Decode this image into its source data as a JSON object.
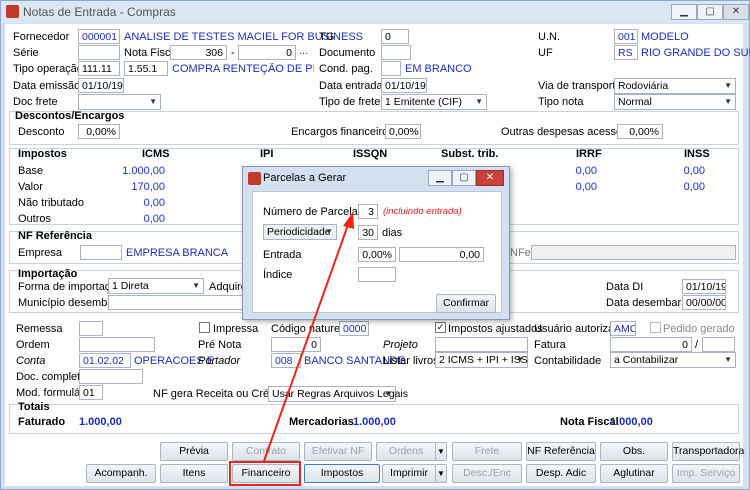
{
  "window": {
    "title": "Notas de Entrada - Compras"
  },
  "header": {
    "fornecedor_label": "Fornecedor",
    "fornecedor_code": "000001",
    "fornecedor_name": "ANALISE DE TESTES MACIEL FOR BUSINESS",
    "tg_label": "TG",
    "tg_value": "0",
    "un_label": "U.N.",
    "un_code": "001",
    "un_name": "MODELO",
    "serie_label": "Série",
    "nota_fiscal_label": "Nota Fiscal",
    "nota_fiscal_value": "306",
    "nota_dash": "-",
    "nota_suffix": "0",
    "ellipsis": "...",
    "documento_label": "Documento",
    "uf_label": "UF",
    "uf_code": "RS",
    "uf_name": "RIO GRANDE DO SUL",
    "tipo_operacao_label": "Tipo operação",
    "tipo_op_code": "111.11",
    "tipo_op_cfop": "1.55.1",
    "tipo_op_desc": "COMPRA RENTEÇÃO DE PIS + COFI",
    "cond_pag_label": "Cond. pag.",
    "cond_pag_desc": "EM BRANCO",
    "data_emissao_label": "Data emissão",
    "data_emissao_value": "01/10/19",
    "data_entrada_label": "Data entrada",
    "data_entrada_value": "01/10/19",
    "via_transporte_label": "Via de transporte",
    "via_transporte_value": "Rodoviária",
    "doc_frete_label": "Doc frete",
    "tipo_frete_label": "Tipo de frete",
    "tipo_frete_value": "1 Emitente (CIF)",
    "tipo_nota_label": "Tipo nota",
    "tipo_nota_value": "Normal"
  },
  "descontos": {
    "title": "Descontos/Encargos",
    "desconto_label": "Desconto",
    "desconto_value": "0,00%",
    "encargos_label": "Encargos financeiros",
    "encargos_value": "0,00%",
    "outras_label": "Outras despesas acessórias",
    "outras_value": "0,00%"
  },
  "impostos": {
    "title": "Impostos",
    "icms": "ICMS",
    "ipi": "IPI",
    "issqn": "ISSQN",
    "subst": "Subst. trib.",
    "irrf": "IRRF",
    "inss": "INSS",
    "base_label": "Base",
    "valor_label": "Valor",
    "nao_trib_label": "Não tributado",
    "outros_label": "Outros",
    "icms_base": "1.000,00",
    "icms_valor": "170,00",
    "icms_nao_trib": "0,00",
    "icms_outros": "0,00",
    "irrf_base": "0,00",
    "irrf_valor": "0,00",
    "inss_base": "0,00",
    "inss_valor": "0,00"
  },
  "nf_ref": {
    "title": "NF Referência",
    "empresa_label": "Empresa",
    "empresa_name": "EMPRESA BRANCA",
    "nfe_label": "NFe"
  },
  "importacao": {
    "title": "Importação",
    "forma_label": "Forma de importação",
    "forma_value": "1 Direta",
    "adquirente_label": "Adquiren",
    "municipio_label": "Município desembaraço",
    "data_di_label": "Data DI",
    "data_di_value": "01/10/19",
    "data_desemb_label": "Data desembaraço",
    "data_desemb_value": "00/00/00"
  },
  "misc": {
    "remessa_label": "Remessa",
    "impressa_label": "Impressa",
    "cod_natureza_label": "Código natureza",
    "cod_natureza_value": "0000",
    "impostos_ajustados_label": "Impostos ajustados",
    "usuario_label": "Usuário autorizado",
    "usuario_value": "AMC",
    "pedido_gerado_label": "Pedido gerado",
    "ordem_label": "Ordem",
    "pre_nota_label": "Pré Nota",
    "pre_nota_value": "0",
    "projeto_label": "Projeto",
    "fatura_label": "Fatura",
    "fatura_value": "0",
    "fatura_sep": "/",
    "conta_label": "Conta",
    "conta_code": "01.02.02",
    "conta_desc": "OPERACOES E",
    "portador_label": "Portador",
    "portador_code": "008",
    "portador_name": "BANCO SANTANDE",
    "listar_livros_label": "Listar livros",
    "listar_livros_value": "2 ICMS + IPI + ISS",
    "contabilidade_label": "Contabilidade",
    "contabilidade_value": "a Contabilizar",
    "doc_completo_label": "Doc. completo",
    "mod_formulario_label": "Mod. formulário",
    "mod_formulario_value": "01",
    "nf_gera_label": "NF gera Receita ou Crédito",
    "nf_gera_value": "Usar Regras Arquivos Legais"
  },
  "totais": {
    "title": "Totais",
    "faturado_label": "Faturado",
    "faturado_value": "1.000,00",
    "mercadorias_label": "Mercadorias",
    "mercadorias_value": "1.000,00",
    "nota_fiscal_label": "Nota Fiscal",
    "nota_fiscal_value": "1.000,00"
  },
  "buttons_row1": {
    "previa": "Prévia",
    "contrato": "Contrato",
    "efetivar_nf": "Efetivar NF",
    "ordens": "Ordens",
    "frete": "Frete",
    "nf_referencia": "NF Referência",
    "obs": "Obs.",
    "transportadora": "Transportadora"
  },
  "buttons_row2": {
    "acompanh": "Acompanh.",
    "itens": "Itens",
    "financeiro": "Financeiro",
    "impostos": "Impostos",
    "imprimir": "Imprimir",
    "desc_enc": "Desc./Enc",
    "desp_adic": "Desp. Adic",
    "aglutinar": "Aglutinar",
    "imp_servico": "Imp. Serviço"
  },
  "dialog": {
    "title": "Parcelas a Gerar",
    "num_parcelas_label": "Número de Parcelas",
    "num_parcelas_value": "3",
    "incluindo": "(incluindo entrada)",
    "periodicidade": "Periodicidade",
    "dias_value": "30",
    "dias_label": "dias",
    "entrada_label": "Entrada",
    "entrada_pct": "0,00%",
    "entrada_value": "0,00",
    "indice_label": "Índice",
    "confirmar": "Confirmar"
  },
  "annotation": {
    "color": "#e8261a"
  }
}
